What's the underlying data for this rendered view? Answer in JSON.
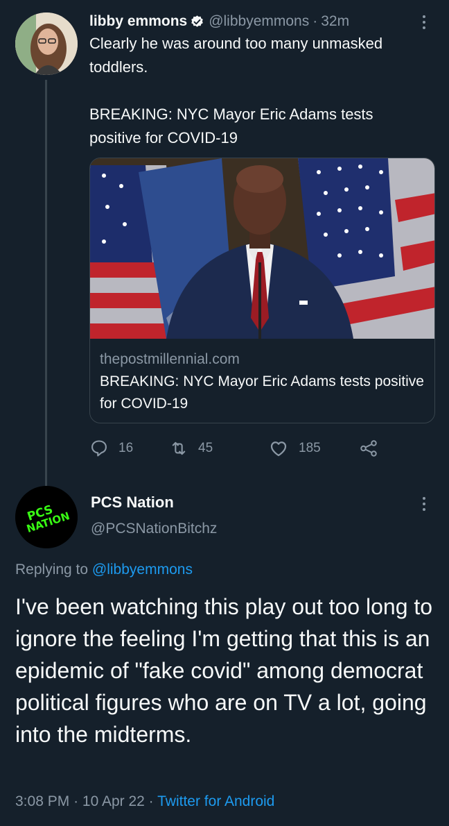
{
  "tweet1": {
    "author_name": "libby emmons",
    "handle": "@libbyemmons",
    "time": "32m",
    "separator": "·",
    "text_paragraphs": [
      "Clearly he was around too many unmasked toddlers.",
      "BREAKING: NYC Mayor Eric Adams tests positive for COVID-19"
    ],
    "card": {
      "domain": "thepostmillennial.com",
      "title": "BREAKING: NYC Mayor Eric Adams tests positive for COVID-19"
    },
    "actions": {
      "replies": "16",
      "retweets": "45",
      "likes": "185"
    }
  },
  "tweet2": {
    "author_name": "PCS Nation",
    "handle": "@PCSNationBitchz",
    "avatar_text_line1": "PCS",
    "avatar_text_line2": "NATION",
    "replying_prefix": "Replying to",
    "replying_to": "@libbyemmons",
    "text": "I've been watching this play out too long to ignore the feeling I'm getting that this is an epidemic of \"fake covid\" among democrat political figures who are on TV a lot, going into the midterms.",
    "time": "3:08 PM",
    "date": "10 Apr 22",
    "separator": "·",
    "source": "Twitter for Android"
  },
  "colors": {
    "background": "#15202b",
    "text_primary": "#f7f9f9",
    "text_secondary": "#8b98a5",
    "link": "#1d9bf0",
    "border": "#38444d",
    "avatar_accent": "#39ff14"
  },
  "icons": [
    "verified-badge-icon",
    "more-icon",
    "reply-icon",
    "retweet-icon",
    "like-icon",
    "share-icon"
  ]
}
